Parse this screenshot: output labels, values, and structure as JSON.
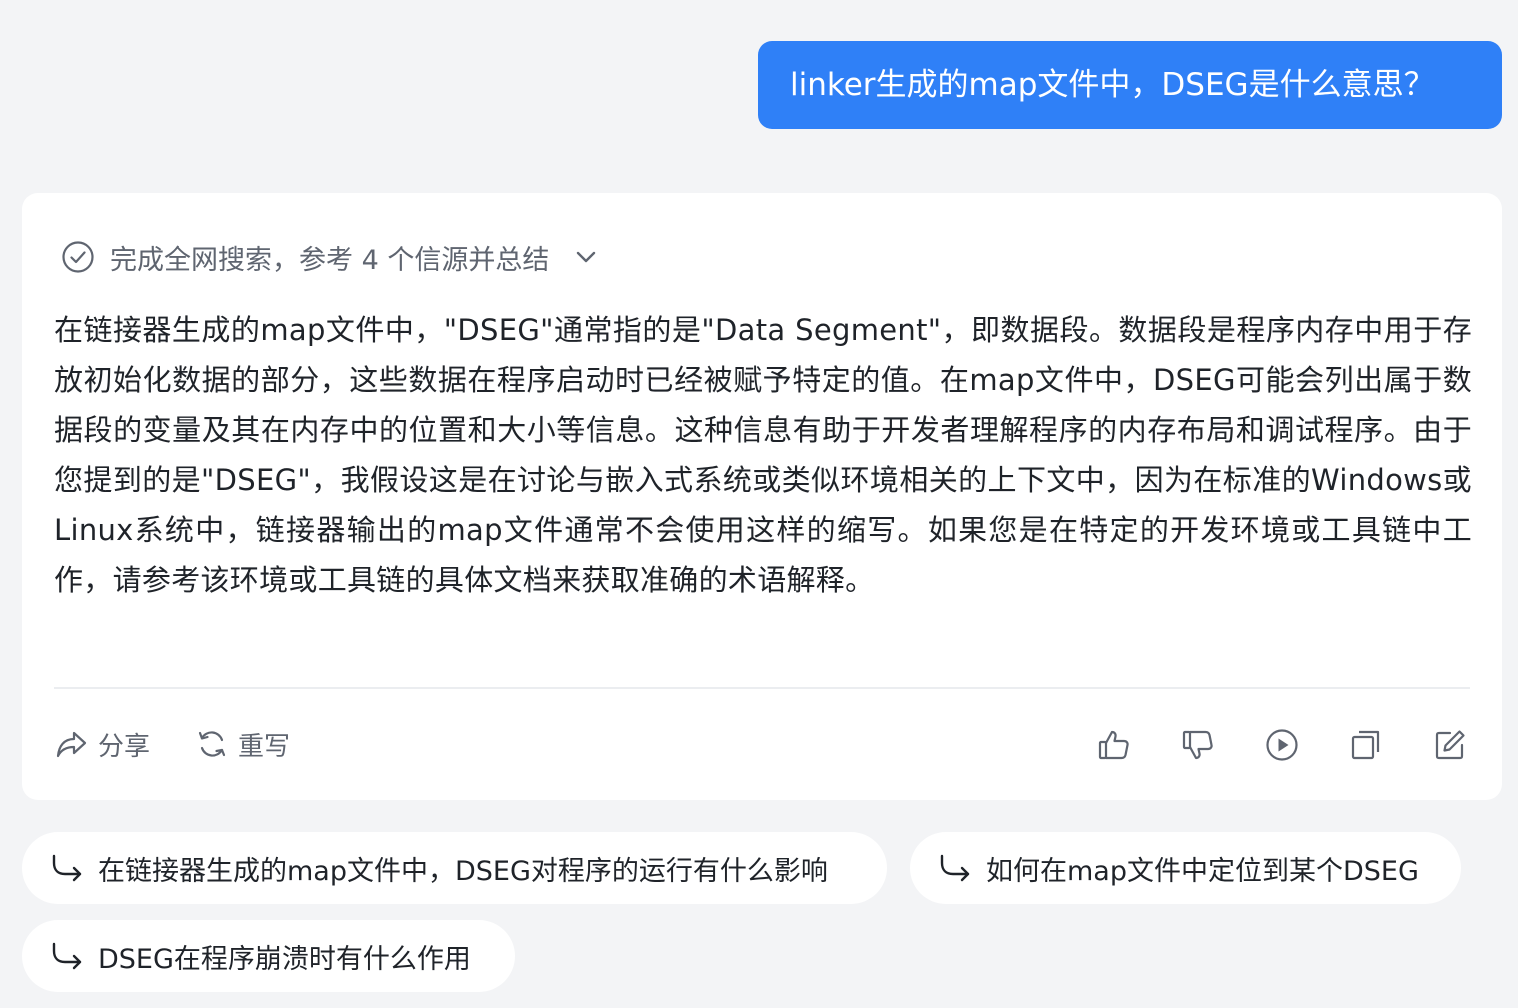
{
  "user_message": "linker生成的map文件中，DSEG是什么意思？",
  "answer": {
    "search_status": "完成全网搜索，参考 4 个信源并总结",
    "text": "在链接器生成的map文件中，\"DSEG\"通常指的是\"Data Segment\"，即数据段。数据段是程序内存中用于存放初始化数据的部分，这些数据在程序启动时已经被赋予特定的值。在map文件中，DSEG可能会列出属于数据段的变量及其在内存中的位置和大小等信息。这种信息有助于开发者理解程序的内存布局和调试程序。由于您提到的是\"DSEG\"，我假设这是在讨论与嵌入式系统或类似环境相关的上下文中，因为在标准的Windows或Linux系统中，链接器输出的map文件通常不会使用这样的缩写。如果您是在特定的开发环境或工具链中工作，请参考该环境或工具链的具体文档来获取准确的术语解释。",
    "actions": {
      "share_label": "分享",
      "rewrite_label": "重写"
    },
    "icon_names": [
      "thumbs-up-icon",
      "thumbs-down-icon",
      "play-icon",
      "copy-icon",
      "edit-icon"
    ]
  },
  "suggestions": [
    "在链接器生成的map文件中，DSEG对程序的运行有什么影响",
    "如何在map文件中定位到某个DSEG",
    "DSEG在程序崩溃时有什么作用"
  ],
  "colors": {
    "accent": "#2f80f7",
    "background": "#f3f4f6",
    "card": "#ffffff",
    "text": "#1f2329",
    "muted": "#5f6570"
  }
}
